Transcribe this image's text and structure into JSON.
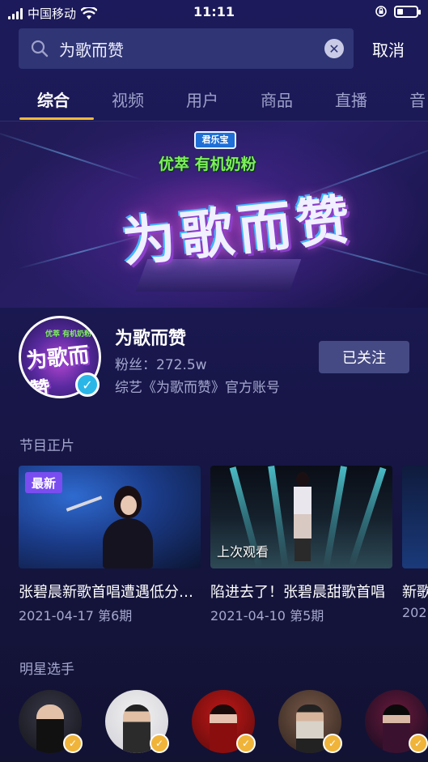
{
  "status_bar": {
    "carrier": "中国移动",
    "time": "11:11",
    "icons": [
      "signal-icon",
      "wifi-icon",
      "rotation-lock-icon",
      "battery-icon"
    ]
  },
  "search": {
    "query": "为歌而赞",
    "cancel_label": "取消",
    "icons": [
      "search-icon",
      "clear-icon"
    ]
  },
  "tabs": [
    {
      "label": "综合",
      "active": true
    },
    {
      "label": "视频",
      "active": false
    },
    {
      "label": "用户",
      "active": false
    },
    {
      "label": "商品",
      "active": false
    },
    {
      "label": "直播",
      "active": false
    },
    {
      "label": "音",
      "active": false
    }
  ],
  "banner": {
    "brand": "君乐宝",
    "slogan": "优萃 有机奶粉",
    "show_logo": "为歌而赞"
  },
  "profile": {
    "name": "为歌而赞",
    "fans": "粉丝：272.5w",
    "description": "综艺《为歌而赞》官方账号",
    "follow_label": "已关注",
    "avatar_text": "为歌而赞",
    "avatar_brand": "优萃 有机奶粉"
  },
  "episodes_section": {
    "title": "节目正片",
    "items": [
      {
        "badge": "最新",
        "overlay": "",
        "title": "张碧晨新歌首唱遭遇低分…",
        "meta": "2021-04-17 第6期"
      },
      {
        "badge": "",
        "overlay": "上次观看",
        "title": "陷进去了！张碧晨甜歌首唱",
        "meta": "2021-04-10 第5期"
      },
      {
        "badge": "",
        "overlay": "",
        "title": "新歌",
        "meta": "202"
      }
    ]
  },
  "stars_section": {
    "title": "明星选手",
    "items": [
      {
        "name": "star-1",
        "verified": true
      },
      {
        "name": "star-2",
        "verified": true
      },
      {
        "name": "star-3",
        "verified": true
      },
      {
        "name": "star-4",
        "verified": true
      },
      {
        "name": "star-5",
        "verified": true
      }
    ]
  },
  "colors": {
    "accent_underline": "#f5b939",
    "new_badge": "#7a4df0",
    "verify_blue": "#2bb6e8",
    "verify_gold": "#f0b43a",
    "follow_button": "#454a84"
  }
}
